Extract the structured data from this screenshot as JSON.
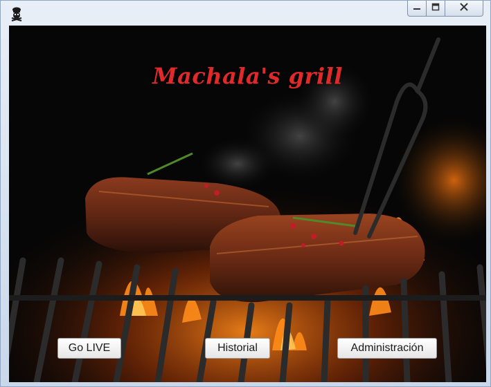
{
  "window": {
    "controls": {
      "minimize_icon": "minimize-icon",
      "maximize_icon": "maximize-icon",
      "close_icon": "close-icon"
    },
    "app_icon": "chef-skull-icon"
  },
  "hero": {
    "title": "Machala's grill",
    "title_color": "#e02a2a"
  },
  "buttons": {
    "go_live": "Go LIVE",
    "historial": "Historial",
    "administracion": "Administración"
  }
}
